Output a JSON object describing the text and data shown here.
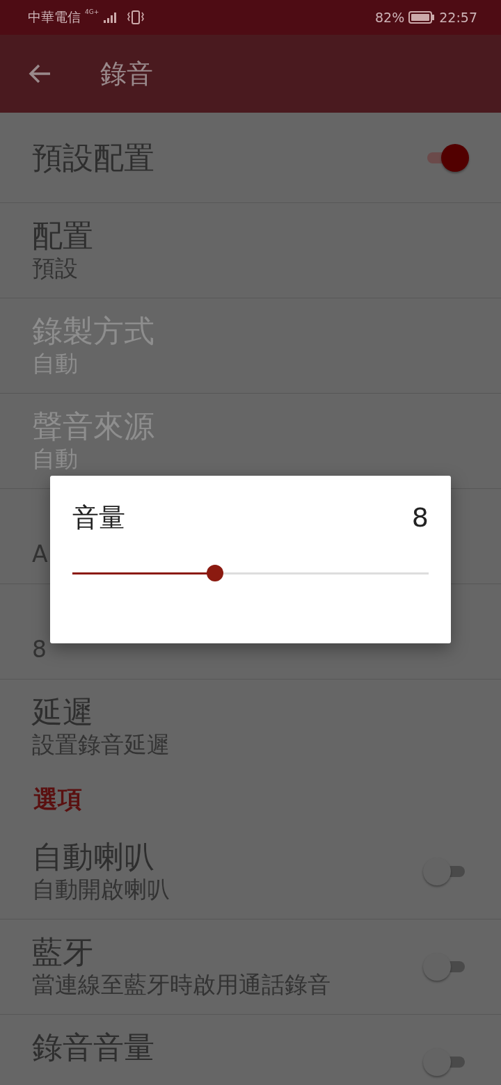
{
  "status_bar": {
    "carrier": "中華電信",
    "network": "4G+",
    "battery": "82%",
    "time": "22:57"
  },
  "toolbar": {
    "title": "錄音"
  },
  "settings": [
    {
      "kind": "switch",
      "title": "預設配置",
      "on": true
    },
    {
      "kind": "item",
      "title": "配置",
      "subtitle": "預設",
      "disabled": false
    },
    {
      "kind": "item",
      "title": "錄製方式",
      "subtitle": "自動",
      "disabled": true
    },
    {
      "kind": "item",
      "title": "聲音來源",
      "subtitle": "自動",
      "disabled": true
    },
    {
      "kind": "item",
      "subtitle": "A",
      "disabled": false
    },
    {
      "kind": "item",
      "subtitle": "8",
      "disabled": false
    },
    {
      "kind": "item",
      "title": "延遲",
      "subtitle": "設置錄音延遲",
      "disabled": false
    },
    {
      "kind": "header",
      "title": "選項"
    },
    {
      "kind": "switch",
      "title": "自動喇叭",
      "subtitle": "自動開啟喇叭",
      "on": false
    },
    {
      "kind": "switch",
      "title": "藍牙",
      "subtitle": "當連線至藍牙時啟用通話錄音",
      "on": false
    },
    {
      "kind": "switch",
      "title": "錄音音量",
      "on": false
    }
  ],
  "dialog": {
    "title": "音量",
    "value": "8",
    "level": 0.4
  }
}
